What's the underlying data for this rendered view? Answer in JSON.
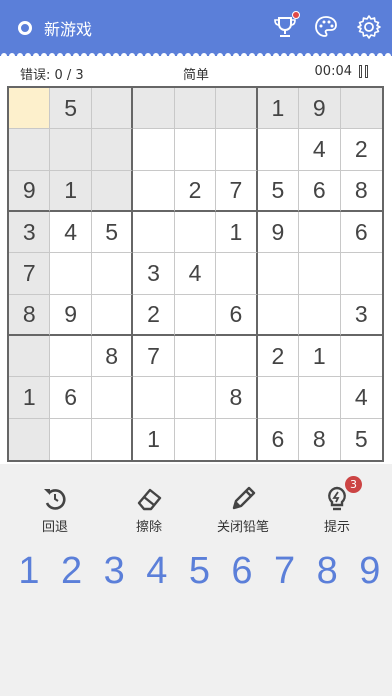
{
  "header": {
    "new_game_label": "新游戏",
    "trophy_icon": "trophy-icon",
    "palette_icon": "palette-icon",
    "settings_icon": "gear-icon",
    "accent_color": "#5b7fd9"
  },
  "status": {
    "errors": "错误: 0 / 3",
    "difficulty": "简单",
    "timer": "00:04"
  },
  "board": {
    "rows": [
      [
        "",
        "5",
        "",
        "",
        "",
        "",
        "1",
        "9",
        ""
      ],
      [
        "",
        "",
        "",
        "",
        "",
        "",
        "",
        "4",
        "2"
      ],
      [
        "9",
        "1",
        "",
        "",
        "2",
        "7",
        "5",
        "6",
        "8"
      ],
      [
        "3",
        "4",
        "5",
        "",
        "",
        "1",
        "9",
        "",
        "6"
      ],
      [
        "7",
        "",
        "",
        "3",
        "4",
        "",
        "",
        "",
        ""
      ],
      [
        "8",
        "9",
        "",
        "2",
        "",
        "6",
        "",
        "",
        "3"
      ],
      [
        "",
        "",
        "8",
        "7",
        "",
        "",
        "2",
        "1",
        ""
      ],
      [
        "1",
        "6",
        "",
        "",
        "",
        "8",
        "",
        "",
        "4"
      ],
      [
        "",
        "",
        "",
        "1",
        "",
        "",
        "6",
        "8",
        "5"
      ]
    ],
    "selected_cell": [
      0,
      0
    ],
    "selected_color": "#fdf0cc",
    "highlight_color": "#e8e8e8"
  },
  "actions": {
    "undo": "回退",
    "erase": "擦除",
    "pencil": "关闭铅笔",
    "hint": "提示",
    "hint_count": "3"
  },
  "numpad": [
    "1",
    "2",
    "3",
    "4",
    "5",
    "6",
    "7",
    "8",
    "9"
  ]
}
